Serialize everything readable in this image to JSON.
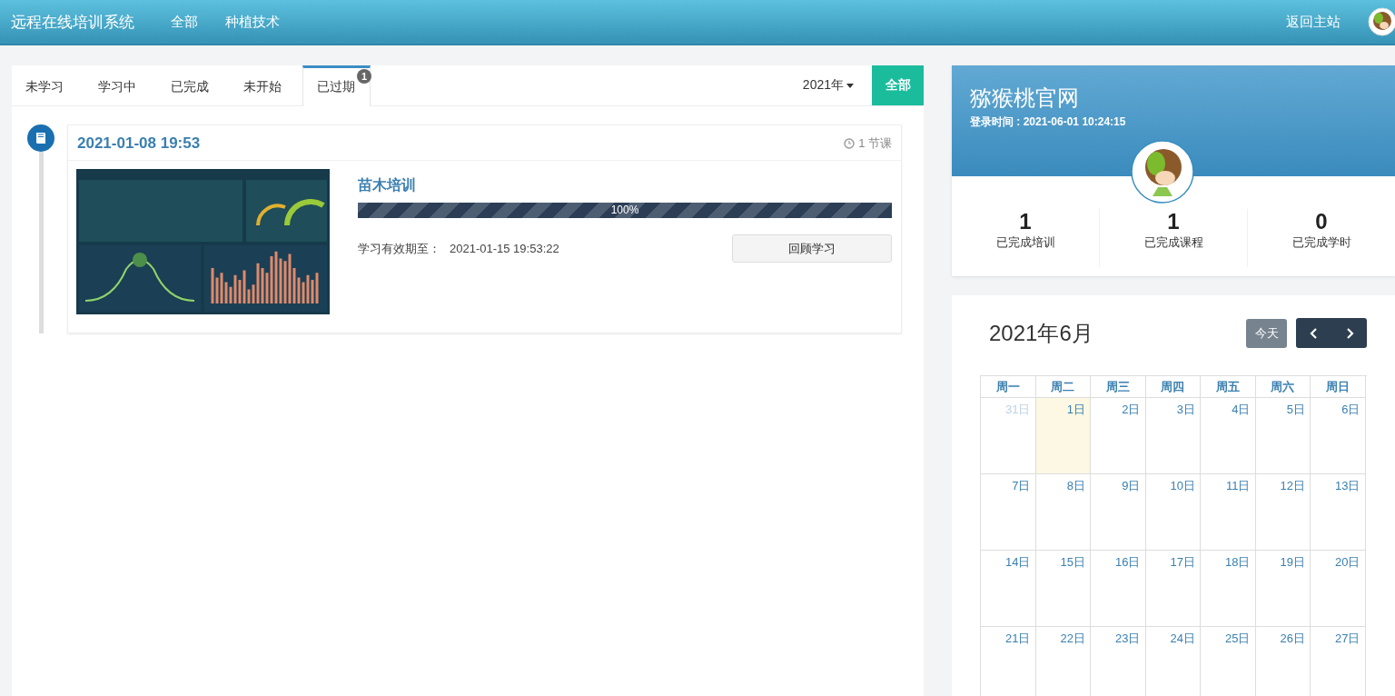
{
  "header": {
    "title": "远程在线培训系统",
    "nav": [
      {
        "label": "全部"
      },
      {
        "label": "种植技术"
      }
    ],
    "home_link": "返回主站"
  },
  "tabs": [
    {
      "label": "未学习",
      "selected": false
    },
    {
      "label": "学习中",
      "selected": false
    },
    {
      "label": "已完成",
      "selected": false
    },
    {
      "label": "未开始",
      "selected": false
    },
    {
      "label": "已过期",
      "selected": true,
      "badge": "1"
    }
  ],
  "year_dropdown": "2021年",
  "filter_button": "全部",
  "timeline": [
    {
      "date": "2021-01-08 19:53",
      "lesson_count": "1 节课",
      "courses": [
        {
          "title": "苗木培训",
          "level": 1,
          "progress_text": "100%",
          "validity_label": "学习有效期至：",
          "validity_date": "2021-01-15 19:53:22",
          "button": "回顾学习"
        }
      ]
    }
  ],
  "profile": {
    "name": "猕猴桃官网",
    "login_time": "登录时间 : 2021-06-01 10:24:15",
    "stats": [
      {
        "value": "1",
        "label": "已完成培训"
      },
      {
        "value": "1",
        "label": "已完成课程"
      },
      {
        "value": "0",
        "label": "已完成学时"
      }
    ]
  },
  "calendar": {
    "title": "2021年6月",
    "today_button": "今天",
    "weekdays": [
      "周一",
      "周二",
      "周三",
      "周四",
      "周五",
      "周六",
      "周日"
    ],
    "weeks": [
      [
        {
          "label": "31日",
          "other_month": true,
          "selected": false
        },
        {
          "label": "1日",
          "other_month": false,
          "selected": true
        },
        {
          "label": "2日",
          "other_month": false,
          "selected": false
        },
        {
          "label": "3日",
          "other_month": false,
          "selected": false
        },
        {
          "label": "4日",
          "other_month": false,
          "selected": false
        },
        {
          "label": "5日",
          "other_month": false,
          "selected": false
        },
        {
          "label": "6日",
          "other_month": false,
          "selected": false
        }
      ],
      [
        {
          "label": "7日",
          "other_month": false,
          "selected": false
        },
        {
          "label": "8日",
          "other_month": false,
          "selected": false
        },
        {
          "label": "9日",
          "other_month": false,
          "selected": false
        },
        {
          "label": "10日",
          "other_month": false,
          "selected": false
        },
        {
          "label": "11日",
          "other_month": false,
          "selected": false
        },
        {
          "label": "12日",
          "other_month": false,
          "selected": false
        },
        {
          "label": "13日",
          "other_month": false,
          "selected": false
        }
      ],
      [
        {
          "label": "14日",
          "other_month": false,
          "selected": false
        },
        {
          "label": "15日",
          "other_month": false,
          "selected": false
        },
        {
          "label": "16日",
          "other_month": false,
          "selected": false
        },
        {
          "label": "17日",
          "other_month": false,
          "selected": false
        },
        {
          "label": "18日",
          "other_month": false,
          "selected": false
        },
        {
          "label": "19日",
          "other_month": false,
          "selected": false
        },
        {
          "label": "20日",
          "other_month": false,
          "selected": false
        }
      ],
      [
        {
          "label": "21日",
          "other_month": false,
          "selected": false
        },
        {
          "label": "22日",
          "other_month": false,
          "selected": false
        },
        {
          "label": "23日",
          "other_month": false,
          "selected": false
        },
        {
          "label": "24日",
          "other_month": false,
          "selected": false
        },
        {
          "label": "25日",
          "other_month": false,
          "selected": false
        },
        {
          "label": "26日",
          "other_month": false,
          "selected": false
        },
        {
          "label": "27日",
          "other_month": false,
          "selected": false
        }
      ]
    ]
  }
}
